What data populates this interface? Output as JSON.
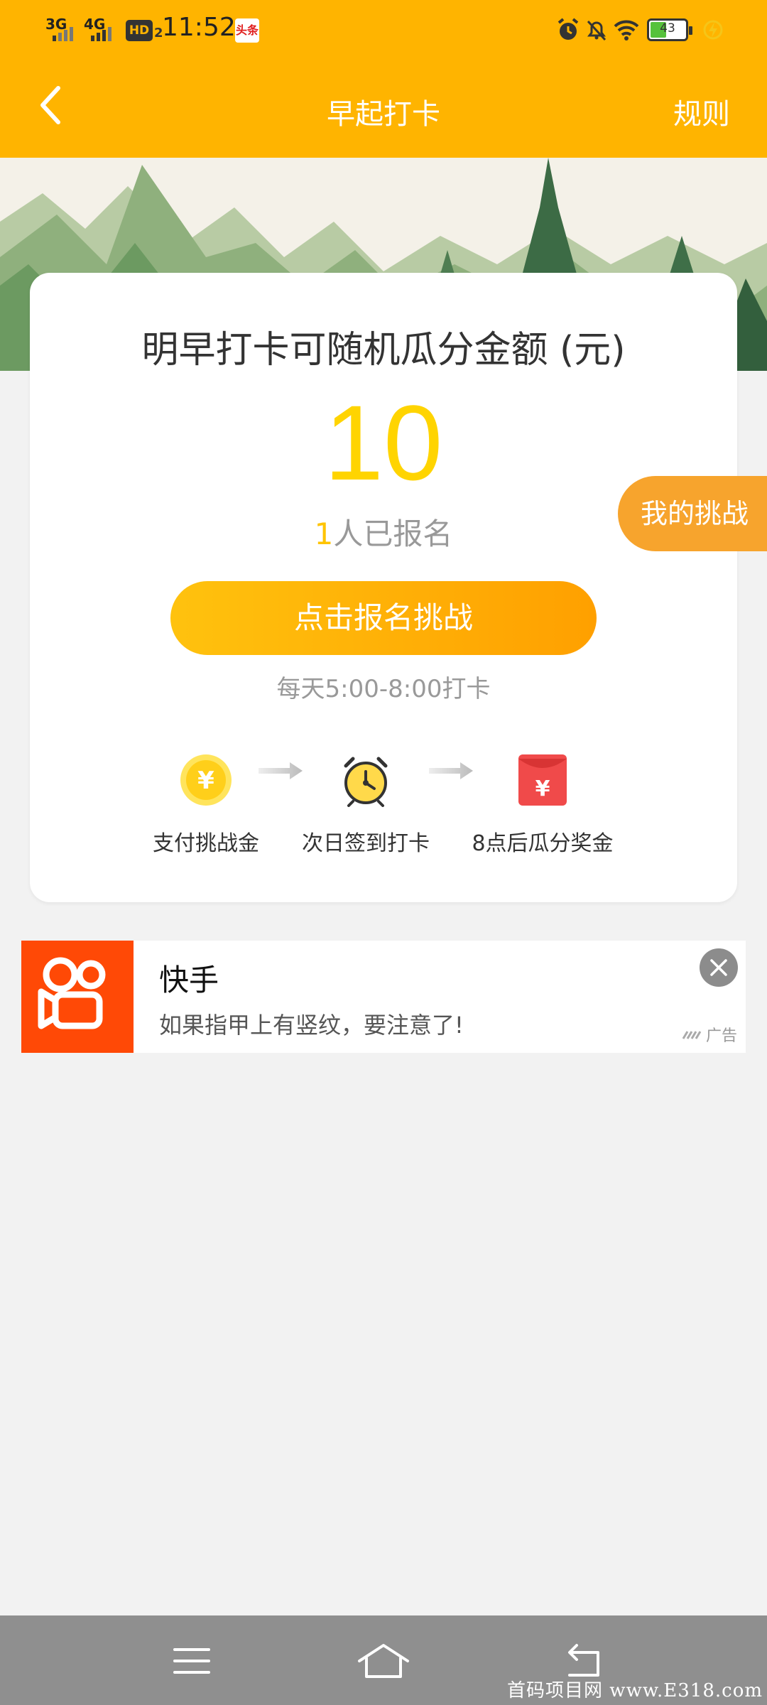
{
  "status_bar": {
    "net1": "3G",
    "net2": "4G",
    "hd": "HD",
    "hd_sub": "2",
    "time": "11:52",
    "app_badge": "头条",
    "battery": "43"
  },
  "header": {
    "title": "早起打卡",
    "rules": "规则"
  },
  "card": {
    "heading": "明早打卡可随机瓜分金额 (元)",
    "amount": "10",
    "signup_count": "1",
    "signup_suffix": "人已报名",
    "cta": "点击报名挑战",
    "time_note": "每天5:00-8:00打卡",
    "steps": [
      {
        "label": "支付挑战金",
        "icon": "coin-yuan-icon"
      },
      {
        "label": "次日签到打卡",
        "icon": "alarm-clock-icon"
      },
      {
        "label": "8点后瓜分奖金",
        "icon": "red-envelope-icon"
      }
    ]
  },
  "floating": {
    "my_challenge": "我的挑战"
  },
  "ad": {
    "title": "快手",
    "desc": "如果指甲上有竖纹，要注意了!",
    "tag": "广告"
  },
  "watermark": "首码项目网 www.E318.com",
  "colors": {
    "brand": "#ffb400",
    "amount": "#ffd400",
    "cta_start": "#ffc20e",
    "cta_end": "#ffa000",
    "ad_logo": "#ff4906",
    "nav": "#8f8f8f"
  }
}
